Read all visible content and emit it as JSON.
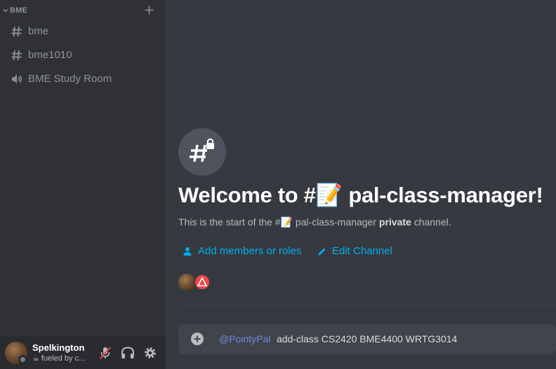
{
  "sidebar": {
    "category": {
      "label": "BME"
    },
    "channels": [
      {
        "name": "bme",
        "icon": "text-channel-icon"
      },
      {
        "name": "bme1010",
        "icon": "text-channel-icon"
      },
      {
        "name": "BME Study Room",
        "icon": "voice-channel-icon"
      }
    ]
  },
  "user": {
    "name": "Spelkington",
    "status_emoji": "☕",
    "status_text": "fueled by c..."
  },
  "main": {
    "welcome_prefix": "Welcome to #",
    "channel_emoji": "📝",
    "channel_name": "pal-class-manager!",
    "sub_start": "This is the start of the #",
    "sub_channel": "pal-class-manager",
    "sub_private": "private",
    "sub_end": "channel.",
    "actions": {
      "add_members": "Add members or roles",
      "edit_channel": "Edit Channel"
    }
  },
  "composer": {
    "mention": "@PointyPal",
    "text": "add-class CS2420 BME4400 WRTG3014"
  },
  "colors": {
    "sidebar_bg": "#2f3136",
    "main_bg": "#36393f",
    "link": "#00aff4",
    "mention": "#7289da",
    "muted_red": "#f04747"
  }
}
